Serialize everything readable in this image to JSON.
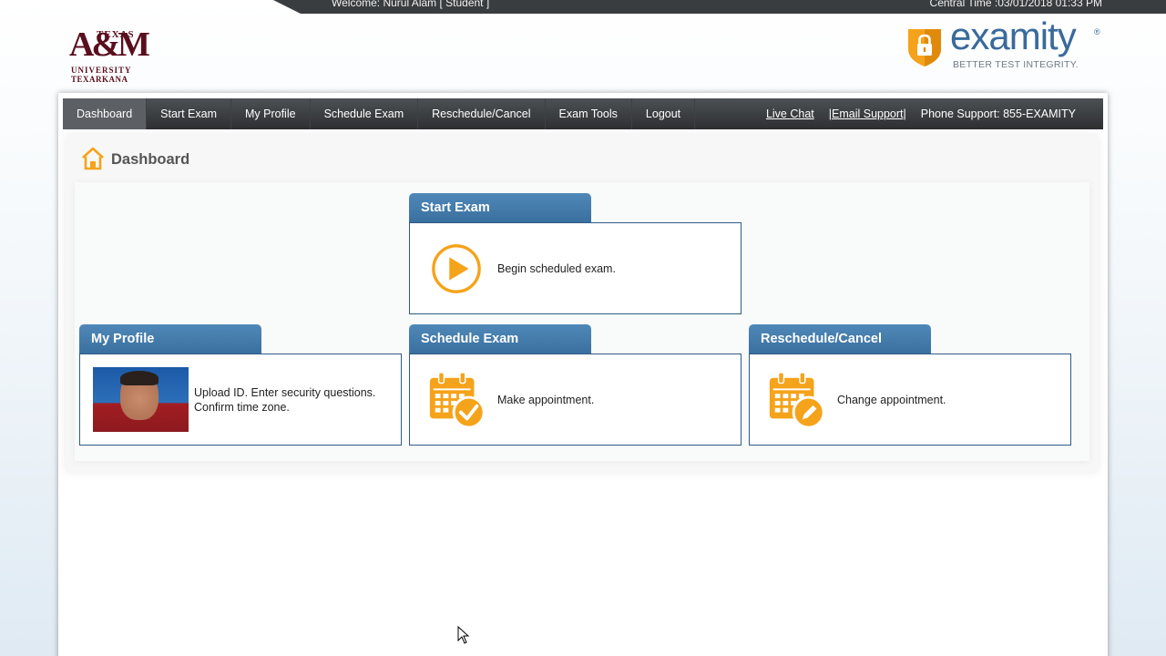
{
  "topbar": {
    "welcome": "Welcome: Nurul Alam [ Student ]",
    "central_time": "Central Time :03/01/2018 01:33 PM"
  },
  "university_logo": {
    "texas": "TEXAS",
    "am": "A&M",
    "university": "UNIVERSITY",
    "texarkana": "TEXARKANA"
  },
  "examity_logo": {
    "name": "examity",
    "registered": "®",
    "tagline": "BETTER TEST INTEGRITY."
  },
  "nav": {
    "items": [
      {
        "label": "Dashboard",
        "active": true
      },
      {
        "label": "Start Exam"
      },
      {
        "label": "My Profile"
      },
      {
        "label": "Schedule Exam"
      },
      {
        "label": "Reschedule/Cancel"
      },
      {
        "label": "Exam Tools"
      },
      {
        "label": "Logout"
      }
    ],
    "live_chat": "Live Chat",
    "email_support": "|Email Support",
    "pipe": "|",
    "phone_support": "Phone Support: 855-EXAMITY"
  },
  "page": {
    "title": "Dashboard",
    "icon": "home-icon"
  },
  "cards": {
    "start_exam": {
      "title": "Start Exam",
      "desc": "Begin scheduled exam.",
      "icon": "play-icon"
    },
    "my_profile": {
      "title": "My Profile",
      "desc_line1": "Upload ID. Enter security questions.",
      "desc_line2": "Confirm time zone.",
      "icon": "profile-photo"
    },
    "schedule_exam": {
      "title": "Schedule Exam",
      "desc": "Make appointment.",
      "icon": "calendar-check-icon"
    },
    "reschedule": {
      "title": "Reschedule/Cancel",
      "desc": "Change appointment.",
      "icon": "calendar-edit-icon"
    }
  },
  "colors": {
    "accent_orange": "#f5a31a",
    "tab_blue": "#3f76a6",
    "nav_dark": "#2d2f31",
    "tamu_maroon": "#5a0f1e",
    "examity_blue": "#3a6a9b"
  }
}
